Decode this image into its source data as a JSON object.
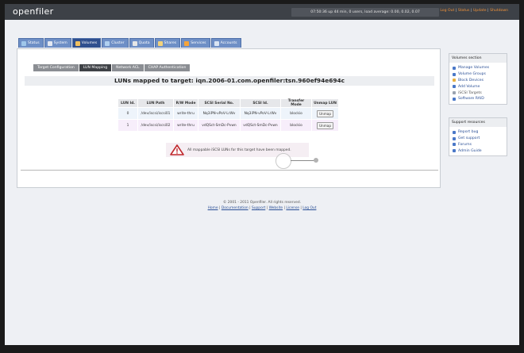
{
  "app": {
    "logo": "openfiler",
    "uptime": "07:50:36 up 44 min, 0 users, load average: 0.00, 0.02, 0.07",
    "top_links": [
      "Log Out",
      "Status",
      "Update",
      "Shutdown"
    ]
  },
  "nav_tabs": [
    {
      "label": "Status",
      "icon_color": "#9fc6ea"
    },
    {
      "label": "System",
      "icon_color": "#e3e8f2"
    },
    {
      "label": "Volumes",
      "icon_color": "#f0c060"
    },
    {
      "label": "Cluster",
      "icon_color": "#b0d0f0"
    },
    {
      "label": "Quota",
      "icon_color": "#e6e6e6"
    },
    {
      "label": "Shares",
      "icon_color": "#f3d27a"
    },
    {
      "label": "Services",
      "icon_color": "#f6a43a"
    },
    {
      "label": "Accounts",
      "icon_color": "#d9e4f3"
    }
  ],
  "sub_tabs": [
    "Target Configuration",
    "LUN Mapping",
    "Network ACL",
    "CHAP Authentication"
  ],
  "heading": "LUNs mapped to target: iqn.2006-01.com.openfiler:tsn.960ef94e694c",
  "table": {
    "headers": [
      "LUN Id.",
      "LUN Path",
      "R/W Mode",
      "SCSI Serial No.",
      "SCSI Id.",
      "Transfer Mode",
      "Unmap LUN"
    ],
    "rows": [
      [
        "0",
        "/dev/iscsi/iscsi01",
        "write-thru",
        "Nq3iPN-vPoV-LrWv",
        "Nq3iPN-vPoV-LrWv",
        "blockio",
        "Unmap"
      ],
      [
        "1",
        "/dev/iscsi/iscsi02",
        "write-thru",
        "vdQSct-SmDc-Pvwn",
        "vdQSct-SmDc-Pvwn",
        "blockio",
        "Unmap"
      ]
    ]
  },
  "alert": "All mappable iSCSI LUNs for this target have been mapped.",
  "sidebar": {
    "volumes_section": {
      "title": "Volumes section",
      "items": [
        {
          "label": "Manage Volumes",
          "color": "#4a78c8"
        },
        {
          "label": "Volume Groups",
          "color": "#4a78c8"
        },
        {
          "label": "Block Devices",
          "color": "#e8b040"
        },
        {
          "label": "Add Volume",
          "color": "#4a78c8"
        },
        {
          "label": "iSCSI Targets",
          "color": "#9aa3b0"
        },
        {
          "label": "Software RAID",
          "color": "#4a78c8"
        }
      ]
    },
    "support_resources": {
      "title": "Support resources",
      "items": [
        {
          "label": "Report bug",
          "color": "#4a78c8"
        },
        {
          "label": "Get support",
          "color": "#4a78c8"
        },
        {
          "label": "Forums",
          "color": "#4a78c8"
        },
        {
          "label": "Admin Guide",
          "color": "#4a78c8"
        }
      ]
    }
  },
  "footer": {
    "copyright": "© 2001 - 2011 Openfiler. All rights reserved.",
    "links": [
      "Home",
      "Documentation",
      "Support",
      "Website",
      "License",
      "Log Out"
    ]
  }
}
